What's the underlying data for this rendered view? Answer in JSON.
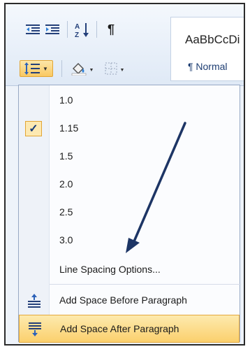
{
  "ribbon": {
    "icons": {
      "decrease_indent": "decrease-indent-icon",
      "increase_indent": "increase-indent-icon",
      "sort": "sort-az-icon",
      "pilcrow": "pilcrow-icon",
      "line_spacing": "line-spacing-icon",
      "shading": "shading-icon",
      "borders": "borders-icon"
    },
    "style_gallery": {
      "sample_text": "AaBbCcDi",
      "style_name": "¶ Normal"
    }
  },
  "line_spacing_menu": {
    "options": [
      "1.0",
      "1.15",
      "1.5",
      "2.0",
      "2.5",
      "3.0"
    ],
    "selected": "1.15",
    "line_spacing_options": "Line Spacing Options...",
    "add_space_before": "Add Space Before Paragraph",
    "add_space_after": "Add Space After Paragraph",
    "highlighted_item": "Add Space After Paragraph"
  },
  "colors": {
    "highlight": "#fbd06d",
    "menu_bg": "#fbfcfe",
    "arrow": "#1d3565"
  }
}
